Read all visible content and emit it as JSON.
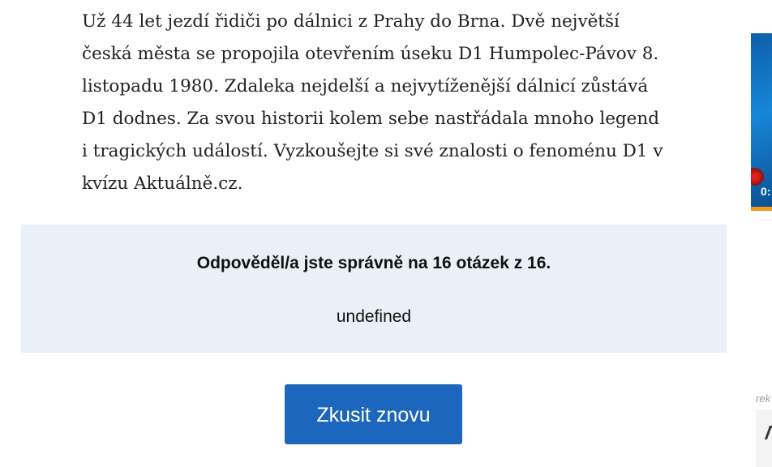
{
  "article": {
    "lines": [
      "Už 44 let jezdí řidiči po dálnici z Prahy do Brna. Dvě největší",
      "česká města se propojila otevřením úseku D1 Humpolec-Pávov 8.",
      "listopadu 1980. Zdaleka nejdelší a nejvytíženější dálnicí zůstává",
      "D1 dodnes. Za svou historii kolem sebe nastřádala mnoho legend",
      "i tragických událostí. Vyzkoušejte si své znalosti o fenoménu D1 v",
      "kvízu Aktuálně.cz."
    ]
  },
  "result": {
    "score_text": "Odpověděl/a jste správně na 16 otázek z 16.",
    "note": "undefined"
  },
  "retry_button": {
    "label": "Zkusit znovu"
  },
  "sidebar": {
    "video_time": "0:",
    "ad_label": "rek"
  },
  "colors": {
    "result_bg": "#e9f0f7",
    "button_bg": "#1c66bd",
    "button_text": "#ffffff",
    "video_progress": "#f29a1a"
  }
}
